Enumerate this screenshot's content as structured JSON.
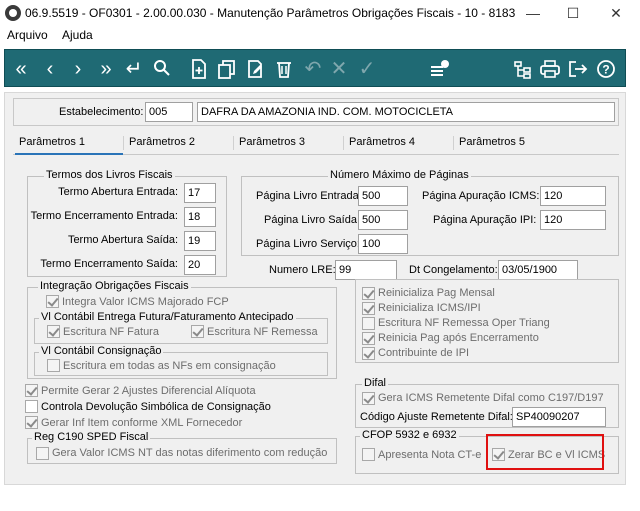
{
  "window": {
    "title": "06.9.5519 - OF0301 - 2.00.00.030 - Manutenção Parâmetros Obrigações Fiscais - 10 - 8183",
    "minimize_glyph": "—",
    "maximize_glyph": "☐",
    "close_glyph": "✕"
  },
  "menu": {
    "items": [
      "Arquivo",
      "Ajuda"
    ]
  },
  "toolbar": {
    "first_glyph": "«",
    "prev_glyph": "‹",
    "next_glyph": "›",
    "last_glyph": "»",
    "return_glyph": "↵",
    "search_glyph": "⌕",
    "undo_glyph": "↶",
    "cancel_glyph": "✕",
    "confirm_glyph": "✓",
    "print_glyph": "⎙",
    "help_glyph": "?",
    "icons": [
      "first-record-icon",
      "previous-record-icon",
      "next-record-icon",
      "last-record-icon",
      "return-icon",
      "search-icon",
      "new-document-icon",
      "copy-icon",
      "edit-icon",
      "delete-icon",
      "undo-icon",
      "cancel-icon",
      "confirm-icon",
      "notes-badge-icon",
      "hierarchy-icon",
      "print-icon",
      "exit-icon",
      "help-icon"
    ],
    "accent": "#1f6a74"
  },
  "estabelecimento": {
    "label": "Estabelecimento:",
    "code": "005",
    "name": "DAFRA DA AMAZONIA IND. COM. MOTOCICLETA"
  },
  "tabs": [
    "Parâmetros 1",
    "Parâmetros 2",
    "Parâmetros 3",
    "Parâmetros 4",
    "Parâmetros 5"
  ],
  "termos": {
    "title": "Termos dos Livros Fiscais",
    "rows": [
      {
        "label": "Termo Abertura Entrada:",
        "value": "17"
      },
      {
        "label": "Termo Encerramento Entrada:",
        "value": "18"
      },
      {
        "label": "Termo Abertura Saída:",
        "value": "19"
      },
      {
        "label": "Termo Encerramento Saída:",
        "value": "20"
      }
    ]
  },
  "paginas": {
    "title": "Número Máximo de Páginas",
    "livro_entrada_label": "Página Livro Entrada:",
    "livro_entrada": "500",
    "livro_saida_label": "Página Livro Saída:",
    "livro_saida": "500",
    "livro_servico_label": "Página Livro Serviço:",
    "livro_servico": "100",
    "apuracao_icms_label": "Página  Apuração ICMS:",
    "apuracao_icms": "120",
    "apuracao_ipi_label": "Página  Apuração IPI:",
    "apuracao_ipi": "120"
  },
  "lre": {
    "label": "Numero LRE:",
    "value": "99"
  },
  "congelamento": {
    "label": "Dt Congelamento:",
    "value": "03/05/1900"
  },
  "integracao": {
    "title": "Integração Obrigações Fiscais",
    "integra_valor": "Integra Valor ICMS Majorado FCP",
    "entrega_title": "Vl Contábil Entrega Futura/Faturamento Antecipado",
    "escrit_fatura": "Escritura NF Fatura",
    "escrit_remessa": "Escritura NF Remessa",
    "consig_title": "Vl Contábil Consignação",
    "escrit_consig": "Escritura em todas as NFs em consignação"
  },
  "right_checks": {
    "reinic_pag_mensal": "Reinicializa Pag Mensal",
    "reinic_icms_ipi": "Reinicializa ICMS/IPI",
    "escrit_remessa_oper": "Escritura NF Remessa Oper Triang",
    "reinicia_pag_apos": "Reinicia Pag após Encerramento",
    "contribuinte_ipi": "Contribuinte de IPI"
  },
  "left_checks": {
    "permite_gerar": "Permite Gerar 2 Ajustes Diferencial Alíquota",
    "controla_devol": "Controla Devolução Simbólica de Consignação",
    "gerar_inf": "Gerar Inf Item conforme XML Fornecedor"
  },
  "reg_c190": {
    "title": "Reg C190 SPED Fiscal",
    "gera_valor": "Gera Valor ICMS NT das notas diferimento com redução"
  },
  "difal": {
    "title": "Difal",
    "gera_icms": "Gera ICMS Remetente Difal como C197/D197",
    "codigo_label": "Código Ajuste Remetente Difal:",
    "codigo": "SP40090207"
  },
  "cfop": {
    "title": "CFOP 5932 e 6932",
    "apresenta": "Apresenta Nota CT-e",
    "zerar": "Zerar BC e Vl ICMS"
  }
}
